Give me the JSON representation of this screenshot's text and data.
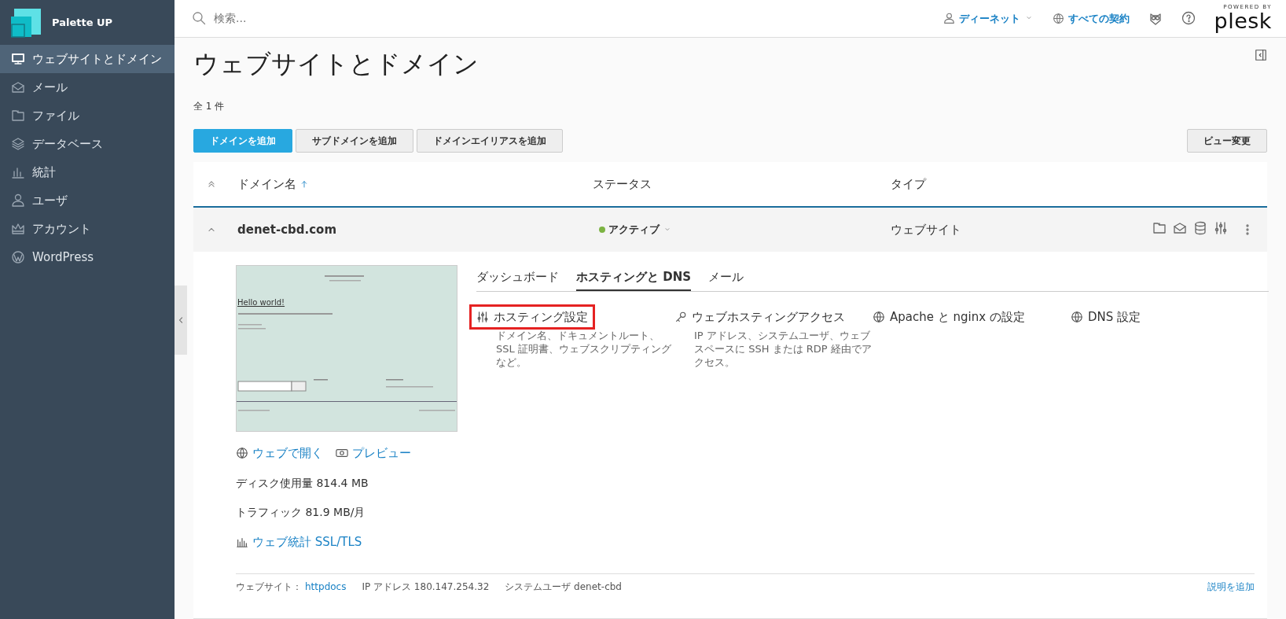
{
  "brand": {
    "name": "Palette UP"
  },
  "sidebar": {
    "items": [
      {
        "label": "ウェブサイトとドメイン",
        "kind": "monitor",
        "selected": true
      },
      {
        "label": "メール",
        "kind": "mail",
        "selected": false
      },
      {
        "label": "ファイル",
        "kind": "folder",
        "selected": false
      },
      {
        "label": "データベース",
        "kind": "layers",
        "selected": false
      },
      {
        "label": "統計",
        "kind": "chart",
        "selected": false
      },
      {
        "label": "ユーザ",
        "kind": "user",
        "selected": false
      },
      {
        "label": "アカウント",
        "kind": "crown",
        "selected": false
      },
      {
        "label": "WordPress",
        "kind": "wordpress",
        "selected": false
      }
    ]
  },
  "topbar": {
    "search": {
      "placeholder": "検索..."
    },
    "user": "ディーネット",
    "subscriptions": "すべての契約",
    "powered_by": "POWERED BY",
    "logo": "plesk"
  },
  "page": {
    "title": "ウェブサイトとドメイン",
    "count": "全 1 件"
  },
  "toolbar": {
    "buttons": [
      {
        "label": "ドメインを追加",
        "primary": true
      },
      {
        "label": "サブドメインを追加",
        "primary": false
      },
      {
        "label": "ドメインエイリアスを追加",
        "primary": false
      }
    ],
    "view_button": "ビュー変更"
  },
  "table": {
    "columns": [
      {
        "label": "ドメイン名",
        "sorted": true
      },
      {
        "label": "ステータス",
        "sorted": false
      },
      {
        "label": "タイプ",
        "sorted": false
      }
    ],
    "rows": [
      {
        "domain": "denet-cbd.com",
        "status": "アクティブ",
        "color": "#7cb342",
        "type": "ウェブサイト",
        "expanded": true,
        "detail": {
          "preview": {
            "heading": "Hello world!"
          },
          "links": [
            {
              "label": "ウェブで開く",
              "kind": "globe"
            },
            {
              "label": "プレビュー",
              "kind": "eye"
            }
          ],
          "disk": "ディスク使用量 814.4 MB",
          "traffic": "トラフィック 81.9 MB/月",
          "stats_link": "ウェブ統計 SSL/TLS",
          "tabs": [
            {
              "label": "ダッシュボード",
              "selected": false
            },
            {
              "label": "ホスティングと DNS",
              "selected": true
            },
            {
              "label": "メール",
              "selected": false
            }
          ],
          "tools": [
            {
              "title": "ホスティング設定",
              "description": "ドメイン名、ドキュメントルート、SSL 証明書、ウェブスクリプティングなど。",
              "kind": "sliders",
              "highlighted": true
            },
            {
              "title": "ウェブホスティングアクセス",
              "description": "IP アドレス、システムユーザ、ウェブスペースに SSH または RDP 経由でアクセス。",
              "kind": "key",
              "highlighted": false
            },
            {
              "title": "Apache と nginx の設定",
              "kind": "globe",
              "highlighted": false
            },
            {
              "title": "DNS 設定",
              "kind": "globe",
              "highlighted": false
            }
          ],
          "footer": {
            "website_label": "ウェブサイト：",
            "website_link": "httpdocs",
            "ip": "IP アドレス 180.147.254.32",
            "user": "システムユーザ denet-cbd",
            "add_description": "説明を追加"
          }
        }
      }
    ]
  }
}
